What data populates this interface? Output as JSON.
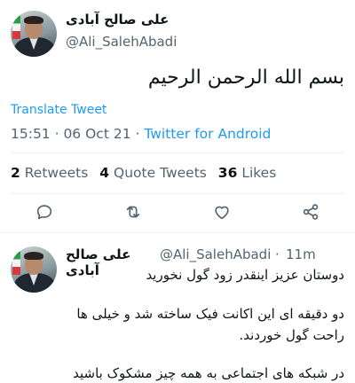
{
  "main_tweet": {
    "display_name": "علی صالح آبادی",
    "handle": "@Ali_SalehAbadi",
    "text": "بسم الله الرحمن الرحیم",
    "translate_label": "Translate Tweet",
    "timestamp": "15:51 · 06 Oct 21 · ",
    "source": "Twitter for Android",
    "stats": {
      "retweets_count": "2",
      "retweets_label": "Retweets",
      "quotes_count": "4",
      "quotes_label": "Quote Tweets",
      "likes_count": "36",
      "likes_label": "Likes"
    },
    "actions": [
      "reply-icon",
      "retweet-icon",
      "like-icon",
      "share-icon"
    ]
  },
  "reply_tweet": {
    "display_name": "علی صالح آبادی",
    "handle": "@Ali_SalehAbadi",
    "separator": "·",
    "time_ago": "11m",
    "lines": [
      "دوستان عزیز اینقدر زود گول نخورید",
      "دو دقیقه ای این اکانت فیک ساخته شد و  خیلی ها",
      "راحت گول خوردند.",
      "در شبکه های اجتماعی به همه چیز مشکوک باشید"
    ]
  },
  "colors": {
    "accent": "#1d9bf0",
    "secondary_text": "#536471",
    "divider": "#eff3f4"
  }
}
